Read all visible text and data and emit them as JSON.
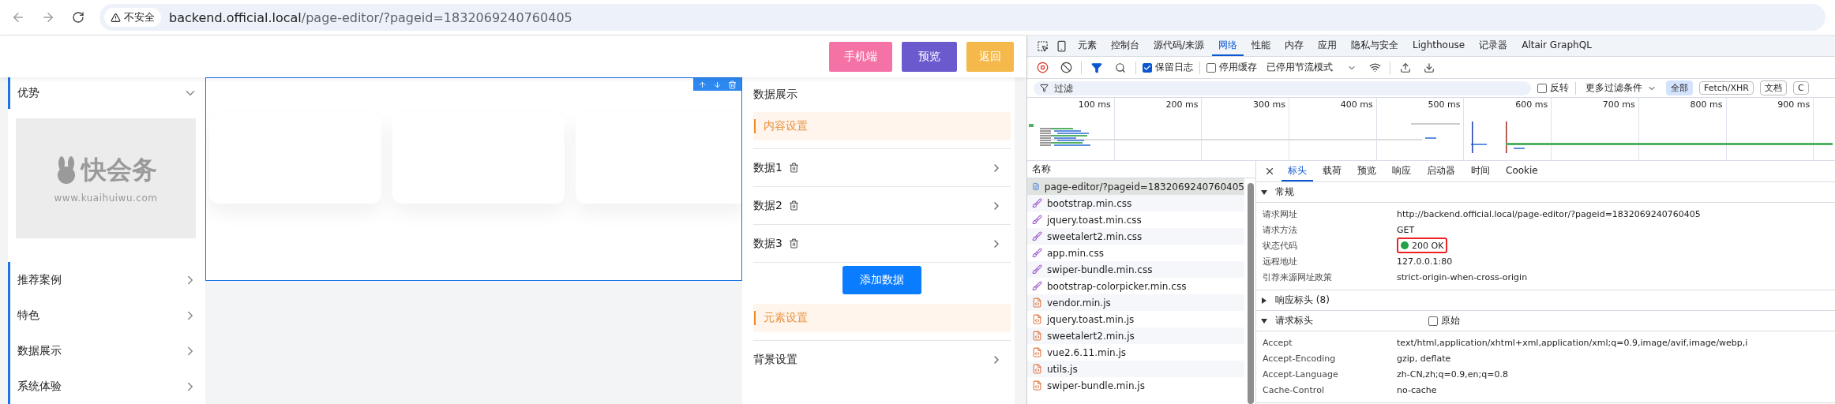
{
  "browser": {
    "security_label": "不安全",
    "url_host": "backend.official.local",
    "url_path": "/page-editor/?pageid=1832069240760405"
  },
  "editor": {
    "header_buttons": [
      {
        "label": "手机端",
        "color": "#f472a6"
      },
      {
        "label": "预览",
        "color": "#6a5acd"
      },
      {
        "label": "返回",
        "color": "#f5b84a"
      }
    ],
    "sidebar": [
      {
        "label": "优势",
        "expanded": true,
        "logo_name": "快会务",
        "logo_url": "www.kuaihuiwu.com"
      },
      {
        "label": "推荐案例",
        "expanded": false
      },
      {
        "label": "特色",
        "expanded": false
      },
      {
        "label": "数据展示",
        "expanded": false
      },
      {
        "label": "系统体验",
        "expanded": false
      }
    ],
    "settings": {
      "title": "数据展示",
      "sections": [
        {
          "title": "内容设置",
          "items": [
            "数据1",
            "数据2",
            "数据3"
          ],
          "add_button": "添加数据"
        },
        {
          "title": "元素设置",
          "items": [
            "背景设置"
          ]
        }
      ]
    }
  },
  "devtools": {
    "tabs": [
      {
        "label": "元素",
        "selected": false
      },
      {
        "label": "控制台",
        "selected": false
      },
      {
        "label": "源代码/来源",
        "selected": false
      },
      {
        "label": "网络",
        "selected": true
      },
      {
        "label": "性能",
        "selected": false
      },
      {
        "label": "内存",
        "selected": false
      },
      {
        "label": "应用",
        "selected": false
      },
      {
        "label": "隐私与安全",
        "selected": false
      },
      {
        "label": "Lighthouse",
        "selected": false
      },
      {
        "label": "记录器",
        "selected": false
      },
      {
        "label": "Altair GraphQL",
        "selected": false
      }
    ],
    "toolbar": {
      "preserve_log": {
        "label": "保留日志",
        "checked": true
      },
      "disable_cache": {
        "label": "停用缓存",
        "checked": false
      },
      "throttling": "已停用节流模式"
    },
    "filter": {
      "placeholder": "过滤",
      "invert": {
        "label": "反转",
        "checked": false
      },
      "more_filters": "更多过滤条件",
      "chips": [
        {
          "label": "全部",
          "selected": true
        },
        {
          "label": "Fetch/XHR",
          "selected": false
        },
        {
          "label": "文档",
          "selected": false
        },
        {
          "label": "C",
          "selected": false
        }
      ]
    },
    "timeline_ticks": [
      "100 ms",
      "200 ms",
      "300 ms",
      "400 ms",
      "500 ms",
      "600 ms",
      "700 ms",
      "800 ms",
      "900 ms"
    ],
    "requests": {
      "column": "名称",
      "rows": [
        {
          "name": "page-editor/?pageid=1832069240760405",
          "kind": "doc",
          "selected": true
        },
        {
          "name": "bootstrap.min.css",
          "kind": "css",
          "selected": false
        },
        {
          "name": "jquery.toast.min.css",
          "kind": "css",
          "selected": false
        },
        {
          "name": "sweetalert2.min.css",
          "kind": "css",
          "selected": false
        },
        {
          "name": "app.min.css",
          "kind": "css",
          "selected": false
        },
        {
          "name": "swiper-bundle.min.css",
          "kind": "css",
          "selected": false
        },
        {
          "name": "bootstrap-colorpicker.min.css",
          "kind": "css",
          "selected": false
        },
        {
          "name": "vendor.min.js",
          "kind": "js",
          "selected": false
        },
        {
          "name": "jquery.toast.min.js",
          "kind": "js",
          "selected": false
        },
        {
          "name": "sweetalert2.min.js",
          "kind": "js",
          "selected": false
        },
        {
          "name": "vue2.6.11.min.js",
          "kind": "js",
          "selected": false
        },
        {
          "name": "utils.js",
          "kind": "js",
          "selected": false
        },
        {
          "name": "swiper-bundle.min.js",
          "kind": "js",
          "selected": false
        }
      ]
    },
    "detail": {
      "tabs": [
        {
          "label": "标头",
          "selected": true
        },
        {
          "label": "载荷",
          "selected": false
        },
        {
          "label": "预览",
          "selected": false
        },
        {
          "label": "响应",
          "selected": false
        },
        {
          "label": "启动器",
          "selected": false
        },
        {
          "label": "时间",
          "selected": false
        },
        {
          "label": "Cookie",
          "selected": false
        }
      ],
      "sections": [
        {
          "title": "常规",
          "expanded": true,
          "rows": [
            {
              "key": "请求网址",
              "value": "http://backend.official.local/page-editor/?pageid=1832069240760405"
            },
            {
              "key": "请求方法",
              "value": "GET"
            },
            {
              "key": "状态代码",
              "value": "200 OK",
              "kind": "status",
              "color": "#1ea446"
            },
            {
              "key": "远程地址",
              "value": "127.0.0.1:80"
            },
            {
              "key": "引荐来源网址政策",
              "value": "strict-origin-when-cross-origin"
            }
          ]
        },
        {
          "title": "响应标头 (8)",
          "expanded": false
        },
        {
          "title": "请求标头",
          "expanded": true,
          "raw": {
            "label": "原始",
            "checked": false
          },
          "rows": [
            {
              "key": "Accept",
              "value": "text/html,application/xhtml+xml,application/xml;q=0.9,image/avif,image/webp,i"
            },
            {
              "key": "Accept-Encoding",
              "value": "gzip, deflate"
            },
            {
              "key": "Accept-Language",
              "value": "zh-CN,zh;q=0.9,en;q=0.8"
            },
            {
              "key": "Cache-Control",
              "value": "no-cache"
            }
          ]
        }
      ]
    }
  }
}
